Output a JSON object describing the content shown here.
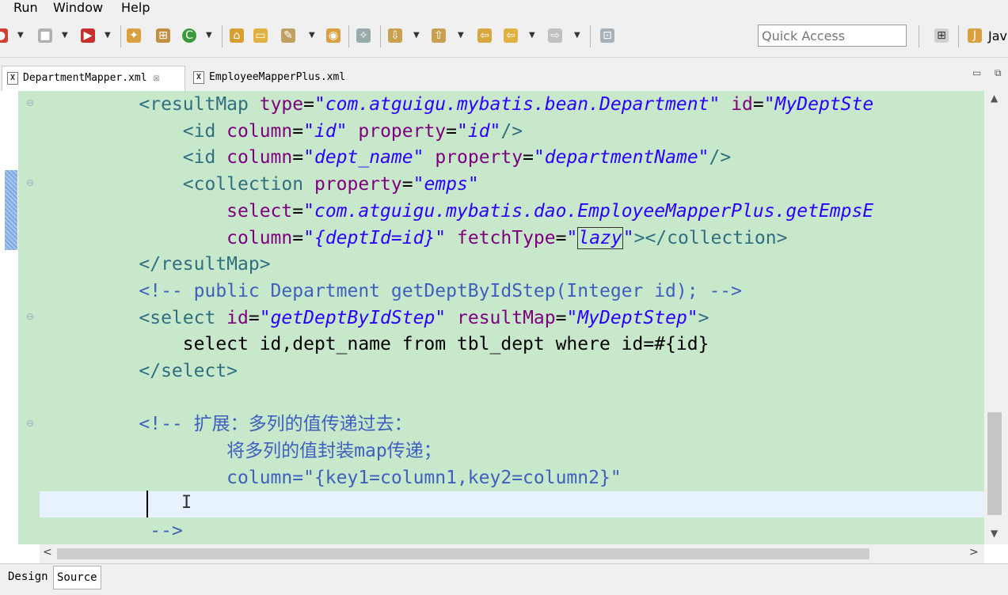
{
  "menu": {
    "items": [
      "Run",
      "Window",
      "Help"
    ]
  },
  "toolbar": {
    "quick_access_placeholder": "Quick Access",
    "perspective_label": "Jav"
  },
  "tabs": [
    {
      "label": "DepartmentMapper.xml",
      "icon": "X",
      "active": true,
      "close": "☒"
    },
    {
      "label": "EmployeeMapperPlus.xml",
      "icon": "X",
      "active": false
    }
  ],
  "editor": {
    "lines": [
      {
        "segments": [
          {
            "t": "    ",
            "c": "txt"
          },
          {
            "t": "<resultMap ",
            "c": "tag"
          },
          {
            "t": "type",
            "c": "attr"
          },
          {
            "t": "=",
            "c": "txt"
          },
          {
            "t": "\"com.atguigu.mybatis.bean.Department\"",
            "c": "val"
          },
          {
            "t": " ",
            "c": "txt"
          },
          {
            "t": "id",
            "c": "attr"
          },
          {
            "t": "=",
            "c": "txt"
          },
          {
            "t": "\"MyDeptSte",
            "c": "val"
          }
        ]
      },
      {
        "segments": [
          {
            "t": "        ",
            "c": "txt"
          },
          {
            "t": "<id ",
            "c": "tag"
          },
          {
            "t": "column",
            "c": "attr"
          },
          {
            "t": "=",
            "c": "txt"
          },
          {
            "t": "\"id\"",
            "c": "val"
          },
          {
            "t": " ",
            "c": "txt"
          },
          {
            "t": "property",
            "c": "attr"
          },
          {
            "t": "=",
            "c": "txt"
          },
          {
            "t": "\"id\"",
            "c": "val"
          },
          {
            "t": "/>",
            "c": "tag"
          }
        ]
      },
      {
        "segments": [
          {
            "t": "        ",
            "c": "txt"
          },
          {
            "t": "<id ",
            "c": "tag"
          },
          {
            "t": "column",
            "c": "attr"
          },
          {
            "t": "=",
            "c": "txt"
          },
          {
            "t": "\"dept_name\"",
            "c": "val"
          },
          {
            "t": " ",
            "c": "txt"
          },
          {
            "t": "property",
            "c": "attr"
          },
          {
            "t": "=",
            "c": "txt"
          },
          {
            "t": "\"departmentName\"",
            "c": "val"
          },
          {
            "t": "/>",
            "c": "tag"
          }
        ]
      },
      {
        "segments": [
          {
            "t": "        ",
            "c": "txt"
          },
          {
            "t": "<collection ",
            "c": "tag"
          },
          {
            "t": "property",
            "c": "attr"
          },
          {
            "t": "=",
            "c": "txt"
          },
          {
            "t": "\"emps\"",
            "c": "val"
          }
        ]
      },
      {
        "segments": [
          {
            "t": "            ",
            "c": "txt"
          },
          {
            "t": "select",
            "c": "attr"
          },
          {
            "t": "=",
            "c": "txt"
          },
          {
            "t": "\"com.atguigu.mybatis.dao.EmployeeMapperPlus.getEmpsE",
            "c": "val"
          }
        ]
      },
      {
        "segments": [
          {
            "t": "            ",
            "c": "txt"
          },
          {
            "t": "column",
            "c": "attr"
          },
          {
            "t": "=",
            "c": "txt"
          },
          {
            "t": "\"{deptId=id}\"",
            "c": "val"
          },
          {
            "t": " ",
            "c": "txt"
          },
          {
            "t": "fetchType",
            "c": "attr"
          },
          {
            "t": "=",
            "c": "txt"
          },
          {
            "t": "\"",
            "c": "val"
          },
          {
            "t": "lazy",
            "c": "val",
            "box": true
          },
          {
            "t": "\"",
            "c": "val"
          },
          {
            "t": "></collection>",
            "c": "tag"
          }
        ]
      },
      {
        "segments": [
          {
            "t": "    ",
            "c": "txt"
          },
          {
            "t": "</resultMap>",
            "c": "tag"
          }
        ]
      },
      {
        "segments": [
          {
            "t": "    ",
            "c": "txt"
          },
          {
            "t": "<!-- public Department getDeptByIdStep(Integer id); -->",
            "c": "cmt"
          }
        ]
      },
      {
        "segments": [
          {
            "t": "    ",
            "c": "txt"
          },
          {
            "t": "<select ",
            "c": "tag"
          },
          {
            "t": "id",
            "c": "attr"
          },
          {
            "t": "=",
            "c": "txt"
          },
          {
            "t": "\"getDeptByIdStep\"",
            "c": "val"
          },
          {
            "t": " ",
            "c": "txt"
          },
          {
            "t": "resultMap",
            "c": "attr"
          },
          {
            "t": "=",
            "c": "txt"
          },
          {
            "t": "\"MyDeptStep\"",
            "c": "val"
          },
          {
            "t": ">",
            "c": "tag"
          }
        ]
      },
      {
        "segments": [
          {
            "t": "        select id,dept_name from tbl_dept where id=#{id}",
            "c": "txt"
          }
        ]
      },
      {
        "segments": [
          {
            "t": "    ",
            "c": "txt"
          },
          {
            "t": "</select>",
            "c": "tag"
          }
        ]
      },
      {
        "segments": [
          {
            "t": "",
            "c": "txt"
          }
        ]
      },
      {
        "segments": [
          {
            "t": "    ",
            "c": "txt"
          },
          {
            "t": "<!-- 扩展：多列的值传递过去：",
            "c": "cmt"
          }
        ]
      },
      {
        "segments": [
          {
            "t": "            ",
            "c": "txt"
          },
          {
            "t": "将多列的值封装map传递；",
            "c": "cmt"
          }
        ]
      },
      {
        "segments": [
          {
            "t": "            ",
            "c": "txt"
          },
          {
            "t": "column=\"{key1=column1,key2=column2}\"",
            "c": "cmt"
          }
        ]
      },
      {
        "segments": [
          {
            "t": "",
            "c": "txt"
          }
        ]
      },
      {
        "segments": [
          {
            "t": "     ",
            "c": "txt"
          },
          {
            "t": "-->",
            "c": "cmt"
          }
        ]
      }
    ]
  },
  "bottom_tabs": {
    "design": "Design",
    "source": "Source"
  }
}
